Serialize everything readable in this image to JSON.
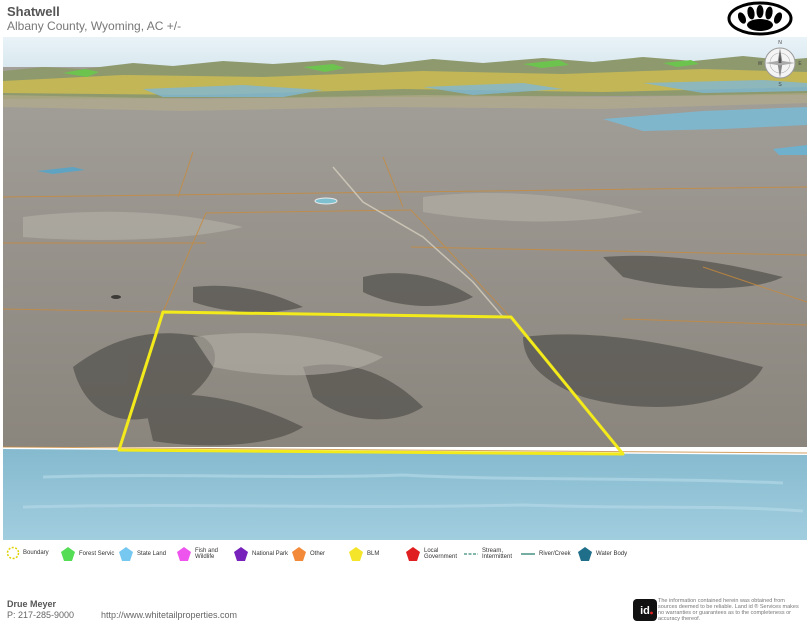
{
  "header": {
    "title": "Shatwell",
    "subtitle": "Albany County, Wyoming,  AC +/-"
  },
  "brand": {
    "logo_icon": "bear-paw-icon"
  },
  "compass": {
    "n": "N",
    "e": "E",
    "s": "S",
    "w": "W"
  },
  "map": {
    "colors": {
      "boundary": "#f2ea1a",
      "road": "#c88a3c",
      "state_land": "#7fb8d4",
      "bureau_land": "#d6c24a",
      "forest": "#6cc44f",
      "terrain": "#8f8b84"
    }
  },
  "legend": [
    {
      "label": "Boundary",
      "icon": "boundary-icon",
      "color": "#f2ea1a"
    },
    {
      "label": "Forest Servic",
      "icon": "forest-service-icon",
      "color": "#55dd55"
    },
    {
      "label": "State Land",
      "icon": "state-land-icon",
      "color": "#77c8f0"
    },
    {
      "label": "Fish and\nWildlife",
      "icon": "fish-wildlife-icon",
      "color": "#ee55ee"
    },
    {
      "label": "National Park",
      "icon": "national-park-icon",
      "color": "#7722bb"
    },
    {
      "label": "Other",
      "icon": "other-icon",
      "color": "#f28a3a"
    },
    {
      "label": "BLM",
      "icon": "blm-icon",
      "color": "#f5e52a"
    },
    {
      "label": "Local\nGovernment",
      "icon": "local-government-icon",
      "color": "#e02020"
    },
    {
      "label": "Stream,\nIntermittent",
      "icon": "stream-intermittent-icon",
      "color": "#3a8a7a"
    },
    {
      "label": "River/Creek",
      "icon": "river-creek-icon",
      "color": "#3a8a7a"
    },
    {
      "label": "Water Body",
      "icon": "water-body-icon",
      "color": "#1f6f8a"
    }
  ],
  "footer": {
    "agent_name": "Drue Meyer",
    "agent_phone": "P: 217-285-9000",
    "website": "http://www.whitetailproperties.com",
    "disclaimer_icon": "landid-logo-icon",
    "disclaimer": "The information contained herein was obtained from sources deemed to be reliable. Land id ® Services makes no warranties or guarantees as to the completeness or accuracy thereof."
  }
}
